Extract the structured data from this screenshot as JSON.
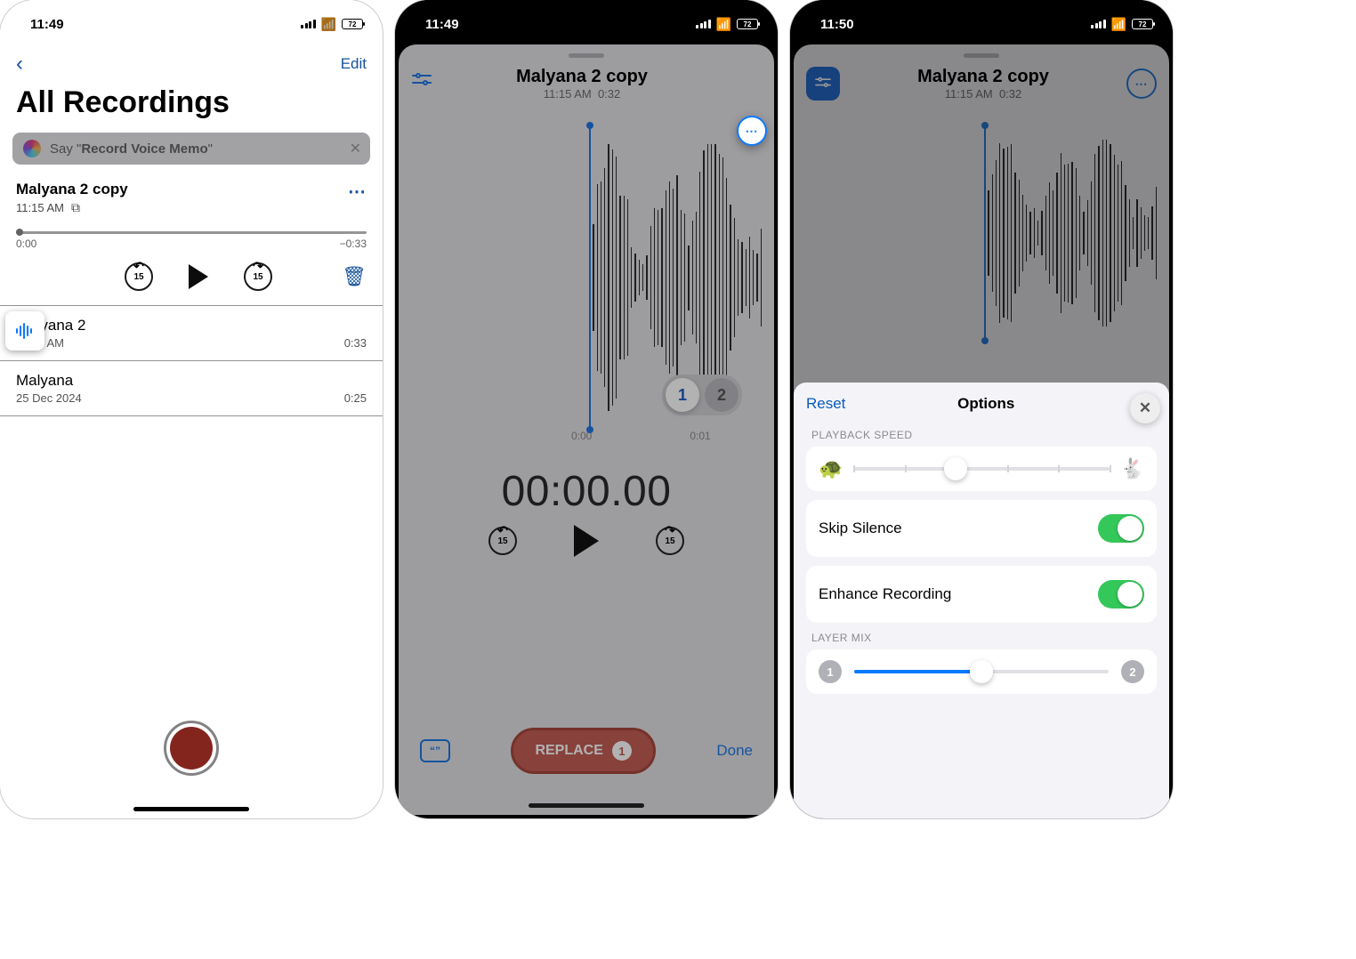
{
  "status": {
    "time_a": "11:49",
    "time_b": "11:49",
    "time_c": "11:50",
    "battery": "72"
  },
  "phone1": {
    "edit": "Edit",
    "title": "All Recordings",
    "siri_prefix": "Say \"",
    "siri_cmd": "Record Voice Memo",
    "siri_suffix": "\"",
    "rec": {
      "name": "Malyana 2 copy",
      "time": "11:15 AM",
      "startTime": "0:00",
      "endTime": "−0:33"
    },
    "controls": {
      "skip_val": "15"
    },
    "list": [
      {
        "name": "Malyana 2",
        "sub": "11:14 AM",
        "dur": "0:33"
      },
      {
        "name": "Malyana",
        "sub": "25 Dec 2024",
        "dur": "0:25"
      }
    ]
  },
  "phone2": {
    "title": "Malyana 2 copy",
    "sub_time": "11:15 AM",
    "sub_dur": "0:32",
    "ticks": {
      "a": "0:00",
      "b": "0:01"
    },
    "layers": {
      "a": "1",
      "b": "2"
    },
    "bigtime": "00:00.00",
    "skip_val": "15",
    "replace": "REPLACE",
    "replace_badge": "1",
    "done": "Done"
  },
  "phone3": {
    "title": "Malyana 2 copy",
    "sub_time": "11:15 AM",
    "sub_dur": "0:32",
    "reset": "Reset",
    "options": "Options",
    "section_speed": "PLAYBACK SPEED",
    "skip_silence": "Skip Silence",
    "enhance": "Enhance Recording",
    "section_mix": "LAYER MIX",
    "mix_a": "1",
    "mix_b": "2"
  }
}
